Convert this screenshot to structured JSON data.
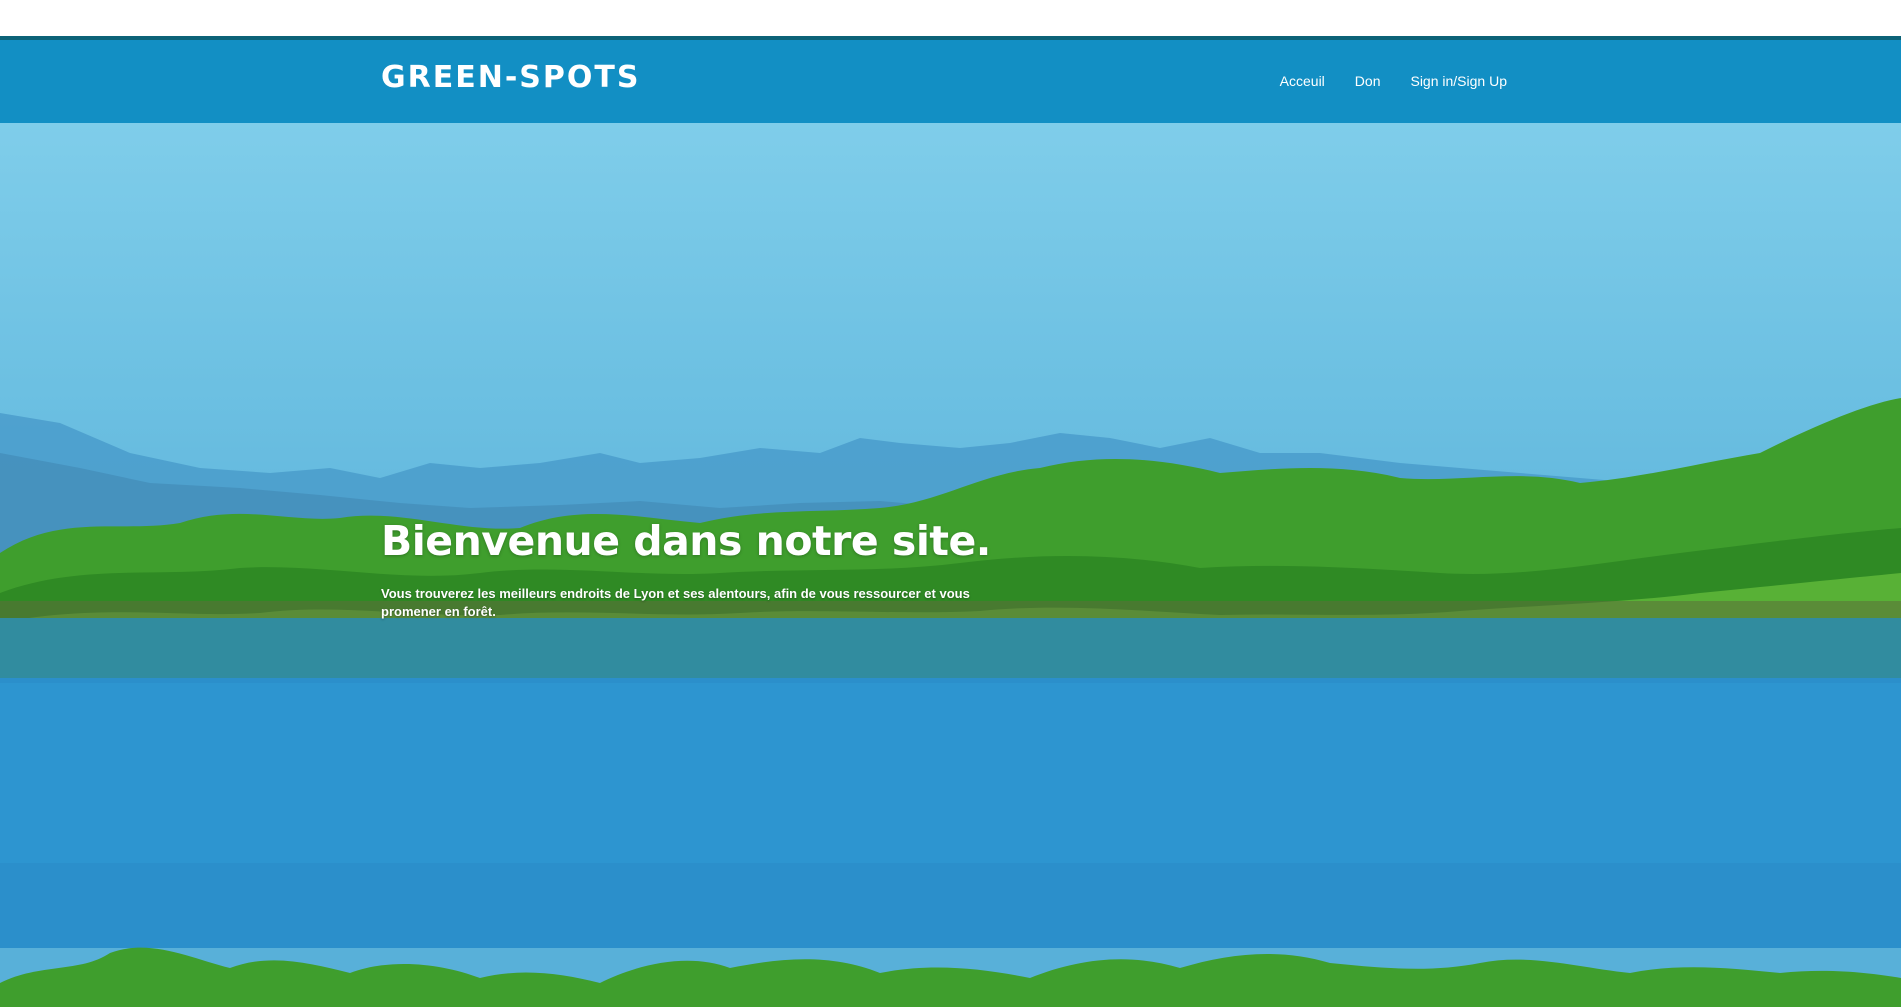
{
  "colors": {
    "navbar": "#128fc4",
    "navbar_border": "#0c6378",
    "sky": "#7fcdea",
    "lake": "#2b8fcb",
    "foliage": "#3f9e2d"
  },
  "navbar": {
    "brand": "GREEN-SPOTS",
    "links": [
      {
        "label": "Acceuil"
      },
      {
        "label": "Don"
      },
      {
        "label": "Sign in/Sign Up"
      }
    ]
  },
  "hero": {
    "title": "Bienvenue dans notre site.",
    "text": "Vous trouverez les meilleurs endroits de Lyon et ses alentours, afin de vous ressourcer et vous promener en forêt.",
    "image": "lake-forest-landscape-image"
  }
}
